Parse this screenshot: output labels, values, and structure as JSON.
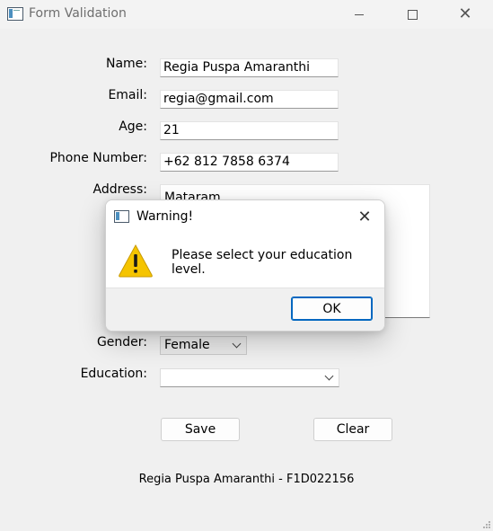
{
  "window": {
    "title": "Form Validation"
  },
  "form": {
    "name_label": "Name:",
    "name_value": "Regia Puspa Amaranthi",
    "email_label": "Email:",
    "email_value": "regia@gmail.com",
    "age_label": "Age:",
    "age_value": "21",
    "phone_label": "Phone Number:",
    "phone_value": "+62 812 7858 6374",
    "address_label": "Address:",
    "address_value": "Mataram",
    "gender_label": "Gender:",
    "gender_value": "Female",
    "education_label": "Education:",
    "education_value": ""
  },
  "buttons": {
    "save": "Save",
    "clear": "Clear"
  },
  "footer": {
    "text": "Regia Puspa Amaranthi - F1D022156"
  },
  "dialog": {
    "title": "Warning!",
    "message": "Please select your education level.",
    "ok": "OK",
    "icon": "warning-icon"
  },
  "colors": {
    "accent": "#0067c0",
    "warning_fill": "#f5c400",
    "background": "#f0f0f0"
  }
}
